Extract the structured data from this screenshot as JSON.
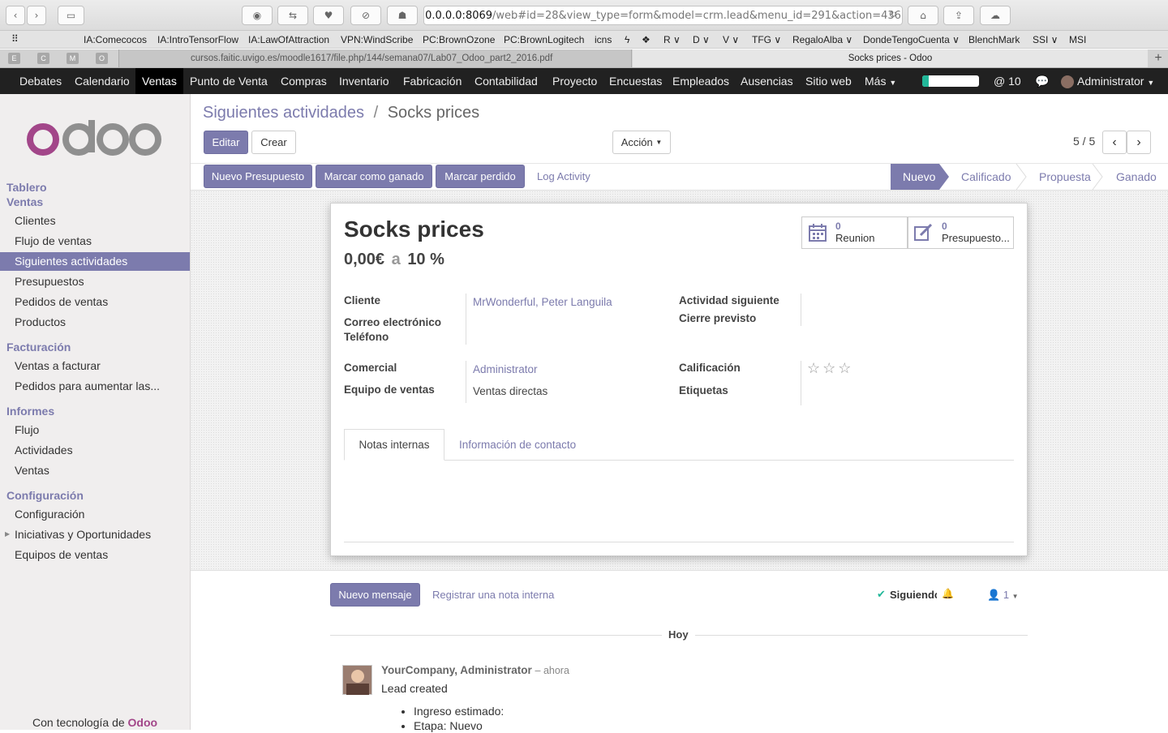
{
  "browser": {
    "url_host": "0.0.0.0:8069",
    "url_rest": "/web#id=28&view_type=form&model=crm.lead&menu_id=291&action=436",
    "bookmarks": [
      "IA:Comecocos",
      "IA:IntroTensorFlow",
      "IA:LawOfAttraction",
      "VPN:WindScribe",
      "PC:BrownOzone",
      "PC:BrownLogitech",
      "icns",
      "ϟ",
      "❖",
      "R ∨",
      "D ∨",
      "V ∨",
      "TFG ∨",
      "RegaloAlba ∨",
      "DondeTengoCuenta ∨",
      "BlenchMark",
      "SSI ∨",
      "MSI"
    ],
    "pinned_tabs": [
      "E",
      "C",
      "M",
      "O"
    ],
    "tabs": [
      {
        "title": "cursos.faitic.uvigo.es/moodle1617/file.php/144/semana07/Lab07_Odoo_part2_2016.pdf"
      },
      {
        "title": "Socks prices - Odoo"
      }
    ]
  },
  "topmenu": {
    "items": [
      "Debates",
      "Calendario",
      "Ventas",
      "Punto de Venta",
      "Compras",
      "Inventario",
      "Fabricación",
      "Contabilidad",
      "Proyecto",
      "Encuestas",
      "Empleados",
      "Ausencias",
      "Sitio web",
      "Más"
    ],
    "active": "Ventas",
    "mentions": "@ 10",
    "user": "Administrator"
  },
  "sidebar": {
    "sections": [
      {
        "title": "Tablero"
      },
      {
        "title": "Ventas"
      },
      {
        "title": "Facturación"
      },
      {
        "title": "Informes"
      },
      {
        "title": "Configuración"
      }
    ],
    "items": [
      "Clientes",
      "Flujo de ventas",
      "Siguientes actividades",
      "Presupuestos",
      "Pedidos de ventas",
      "Productos",
      "Ventas a facturar",
      "Pedidos para aumentar las...",
      "Flujo",
      "Actividades",
      "Ventas",
      "Configuración",
      "Iniciativas y Oportunidades",
      "Equipos de ventas"
    ],
    "active_item": "Siguientes actividades",
    "footer_prefix": "Con tecnología de",
    "footer_brand": "Odoo"
  },
  "breadcrumb": {
    "parent": "Siguientes actividades",
    "separator": "/",
    "current": "Socks prices"
  },
  "control": {
    "edit": "Editar",
    "create": "Crear",
    "action": "Acción",
    "pager": "5 / 5"
  },
  "header_buttons": [
    "Nuevo Presupuesto",
    "Marcar como ganado",
    "Marcar perdido",
    "Log Activity"
  ],
  "stages": [
    "Nuevo",
    "Calificado",
    "Propuesta",
    "Ganado"
  ],
  "current_stage": "Nuevo",
  "record": {
    "name": "Socks prices",
    "revenue": "0,00€",
    "at": "a",
    "probability": "10 %",
    "meetings_count": "0",
    "meetings_label": "Reunion",
    "quotations_count": "0",
    "quotations_label": "Presupuesto...",
    "fields": {
      "cliente_label": "Cliente",
      "cliente_value": "MrWonderful, Peter Languila",
      "email_label": "Correo electrónico",
      "phone_label": "Teléfono",
      "next_activity_label": "Actividad siguiente",
      "closing_label": "Cierre previsto",
      "salesperson_label": "Comercial",
      "salesperson_value": "Administrator",
      "team_label": "Equipo de ventas",
      "team_value": "Ventas directas",
      "rating_label": "Calificación",
      "rating_stars": 0,
      "rating_max": 3,
      "tags_label": "Etiquetas"
    },
    "tabs": [
      "Notas internas",
      "Información de contacto"
    ],
    "active_tab": "Notas internas"
  },
  "chatter": {
    "new_message": "Nuevo mensaje",
    "log_note": "Registrar una nota interna",
    "following": "Siguiendo",
    "followers": "1",
    "date_separator": "Hoy",
    "message": {
      "author": "YourCompany, Administrator",
      "time": "– ahora",
      "body": "Lead created",
      "bullets": [
        "Ingreso estimado:",
        "Etapa: Nuevo"
      ]
    }
  },
  "colors": {
    "accent": "#7c7bad",
    "menubar": "#212121",
    "odoo_pink": "#a24689",
    "odoo_grey": "#8f8f8f",
    "success": "#21b799"
  }
}
